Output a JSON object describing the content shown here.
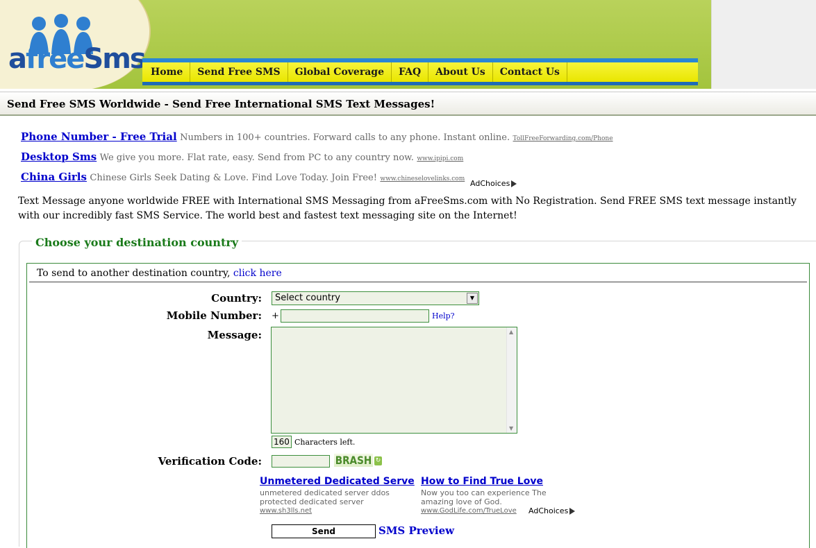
{
  "logo": {
    "part1": "a",
    "part2": "free",
    "part3": "Sms"
  },
  "nav": [
    "Home",
    "Send Free SMS",
    "Global Coverage",
    "FAQ",
    "About Us",
    "Contact Us"
  ],
  "page_title": "Send Free SMS Worldwide - Send Free International SMS Text Messages!",
  "ads": [
    {
      "title": "Phone Number - Free Trial",
      "desc": "Numbers in 100+ countries. Forward calls to any phone. Instant online.",
      "url": "TollFreeForwarding.com/Phone"
    },
    {
      "title": "Desktop Sms",
      "desc": "We give you more. Flat rate, easy. Send from PC to any country now.",
      "url": "www.ipipi.com"
    },
    {
      "title": "China Girls",
      "desc": "Chinese Girls Seek Dating & Love. Find Love Today. Join Free!",
      "url": "www.chineselovelinks.com"
    }
  ],
  "adchoices": "AdChoices",
  "intro": "Text Message anyone worldwide FREE with International SMS Messaging from aFreeSms.com with No Registration. Send FREE SMS text message instantly with our incredibly fast SMS Service. The world best and fastest text messaging site on the Internet!",
  "form": {
    "legend": "Choose your destination country",
    "dest_note": "To send to another destination country,",
    "dest_link": "click here",
    "country_label": "Country:",
    "country_value": "Select country",
    "mobile_label": "Mobile Number:",
    "mobile_prefix": "+",
    "help": "Help?",
    "message_label": "Message:",
    "char_count": "160",
    "chars_left": "Characters left.",
    "verification_label": "Verification Code:",
    "captcha": "BRASH",
    "send": "Send",
    "preview": "SMS Preview"
  },
  "google_ads": [
    {
      "title": "Unmetered Dedicated Serve",
      "desc": "unmetered dedicated server ddos protected dedicated server",
      "url": "www.sh3lls.net"
    },
    {
      "title": "How to Find True Love",
      "desc": "Now you too can experience The amazing love of God.",
      "url": "www.GodLife.com/TrueLove"
    }
  ],
  "colors": {
    "header_green": "#a3c43d",
    "nav_yellow": "#f7f43a",
    "nav_blue": "#2a86d4",
    "form_green": "#3d8f3d",
    "link_blue": "#0000cc"
  }
}
